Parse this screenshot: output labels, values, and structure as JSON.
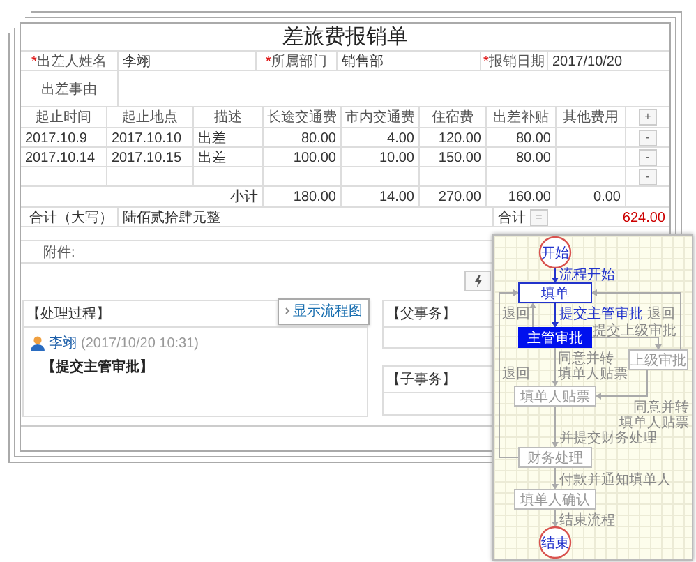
{
  "form": {
    "title": "差旅费报销单",
    "header_fields": [
      {
        "mark": "*",
        "label": "出差人姓名",
        "value": "李翊"
      },
      {
        "mark": "*",
        "label": "所属部门",
        "value": "销售部"
      },
      {
        "mark": "*",
        "label": "报销日期",
        "value": "2017/10/20"
      }
    ],
    "reason": {
      "label": "出差事由"
    },
    "expense_table": {
      "columns": [
        "起止时间",
        "起止地点",
        "描述",
        "长途交通费",
        "市内交通费",
        "住宿费",
        "出差补贴",
        "其他费用"
      ],
      "add_button": "+",
      "rows": [
        {
          "cells": [
            "2017.10.9",
            "2017.10.10",
            "出差",
            "80.00",
            "4.00",
            "120.00",
            "80.00",
            ""
          ],
          "remove_button": "-"
        },
        {
          "cells": [
            "2017.10.14",
            "2017.10.15",
            "出差",
            "100.00",
            "10.00",
            "150.00",
            "80.00",
            ""
          ],
          "remove_button": "-"
        },
        {
          "cells": [
            "",
            "",
            "",
            "",
            "",
            "",
            "",
            ""
          ],
          "remove_button": "-"
        }
      ],
      "subtotal": {
        "label": "小计",
        "values": [
          "180.00",
          "14.00",
          "270.00",
          "160.00",
          "0.00"
        ]
      }
    },
    "total": {
      "label": "合计（大写）",
      "amount_in_words": "陆佰贰拾肆元整",
      "sum_label": "合计",
      "sum_button": "=",
      "amount": "624.00"
    },
    "attachments": {
      "label": "附件:"
    }
  },
  "process": {
    "title": "【处理过程】",
    "flow_tab": "显示流程图",
    "entries": [
      {
        "user": "李翊",
        "time": "(2017/10/20 10:31)",
        "action": "【提交主管审批】"
      }
    ]
  },
  "parent_task": {
    "title": "【父事务】"
  },
  "child_task": {
    "title": "【子事务】"
  },
  "flowchart": {
    "nodes": [
      {
        "label": "开始",
        "kind": "terminal"
      },
      {
        "label": "填单",
        "kind": "task",
        "completed": true,
        "current": false
      },
      {
        "label": "主管审批",
        "kind": "task",
        "completed": false,
        "current": true
      },
      {
        "label": "上级审批",
        "kind": "task",
        "completed": false,
        "current": false
      },
      {
        "label": "填单人贴票",
        "kind": "task",
        "completed": false,
        "current": false
      },
      {
        "label": "财务处理",
        "kind": "task",
        "completed": false,
        "current": false
      },
      {
        "label": "填单人确认",
        "kind": "task",
        "completed": false,
        "current": false
      },
      {
        "label": "结束",
        "kind": "terminal"
      }
    ],
    "edges": [
      {
        "label": "流程开始",
        "traversed": true
      },
      {
        "label": "退回",
        "traversed": false
      },
      {
        "label": "提交主管审批",
        "traversed": true
      },
      {
        "label": "退回",
        "traversed": false
      },
      {
        "label": "提交上级审批",
        "traversed": false
      },
      {
        "label": "退回",
        "traversed": false
      },
      {
        "label": "同意并转填单人贴票",
        "traversed": false
      },
      {
        "label": "同意并转填单人贴票",
        "traversed": false
      },
      {
        "label": "并提交财务处理",
        "traversed": false
      },
      {
        "label": "付款并通知填单人",
        "traversed": false
      },
      {
        "label": "结束流程",
        "traversed": false
      }
    ]
  }
}
